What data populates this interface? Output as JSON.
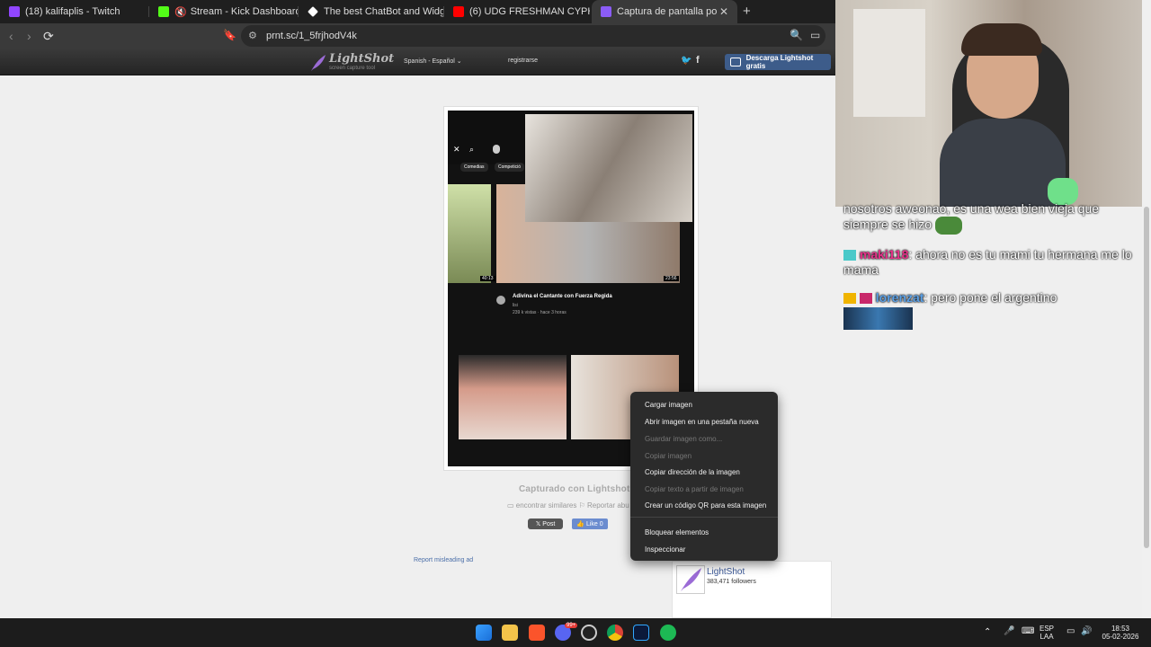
{
  "browser": {
    "tabs": [
      {
        "label": "(18) kalifaplis - Twitch",
        "color": "#9146ff"
      },
      {
        "label": "Stream - Kick Dashboard",
        "color": "#53fc18"
      },
      {
        "label": "The best ChatBot and Widgets for Ki",
        "color": "#ffffff"
      },
      {
        "label": "(6) UDG FRESHMAN CYPHER 2026 -",
        "color": "#ff0000"
      },
      {
        "label": "Captura de pantalla por Lightsh",
        "color": "#8b5cf6"
      }
    ],
    "new_tab_symbol": "+",
    "close_symbol": "✕",
    "url": "prnt.sc/1_5frjhodV4k"
  },
  "lightshot": {
    "brand": "LightShot",
    "tagline": "screen capture tool",
    "language": "Spanish - Español",
    "register": "registrarse",
    "download_button": "Descarga Lightshot gratis",
    "captured_with": "Capturado con Lightshot",
    "links": "▭ encontrar similares  ⚐ Reportar abu",
    "x_post": "𝕏 Post",
    "fb_like": "👍 Like 0",
    "report_ad": "Report misleading ad",
    "fb_widget": {
      "name": "LightShot",
      "followers": "383,471 followers"
    }
  },
  "screenshot_content": {
    "chip_1": "Comedias",
    "chip_2": "Competició",
    "video_title": "Adivina el Cantante con Fuerza Regida",
    "video_channel": "lisi",
    "video_meta": "239 k vistas · hace 3 horas",
    "dur_1": "40:13",
    "dur_2": "23:56"
  },
  "context_menu": {
    "items": [
      {
        "label": "Cargar imagen",
        "enabled": true
      },
      {
        "label": "Abrir imagen en una pestaña nueva",
        "enabled": true
      },
      {
        "label": "Guardar imagen como...",
        "enabled": false
      },
      {
        "label": "Copiar imagen",
        "enabled": false
      },
      {
        "label": "Copiar dirección de la imagen",
        "enabled": true
      },
      {
        "label": "Copiar texto a partir de imagen",
        "enabled": false
      },
      {
        "label": "Crear un código QR para esta imagen",
        "enabled": true
      },
      {
        "label": "Bloquear elementos",
        "enabled": true
      },
      {
        "label": "Inspeccionar",
        "enabled": true
      }
    ]
  },
  "chat": [
    {
      "user": "",
      "text": "nosotros aweonao, es una wea bien vieja que siempre se hizo"
    },
    {
      "user": "maki118",
      "text": ": ahora no es tu mami tu hermana me lo mama"
    },
    {
      "user": "lorenzat",
      "text": ": pero pone el argentino"
    }
  ],
  "taskbar": {
    "lang": "ESP",
    "layout": "LAA",
    "time": "18:53",
    "date": "05-02-2026",
    "badge": "99+"
  }
}
